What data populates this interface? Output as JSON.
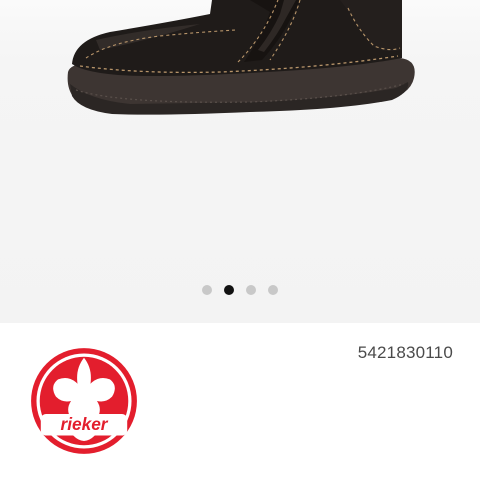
{
  "gallery": {
    "image_label": "shoe-image",
    "pager": {
      "total": 4,
      "active_index": 1
    }
  },
  "product": {
    "brand_logo_text": "rieker",
    "article_number": "5421830110"
  },
  "colors": {
    "brand_red": "#e31e2d",
    "pager_active": "#111111",
    "pager_inactive": "#c8c8c8",
    "gallery_bg": "#f3f3f3",
    "shoe_leather": "#1f1b19",
    "sole": "#3d3532"
  }
}
